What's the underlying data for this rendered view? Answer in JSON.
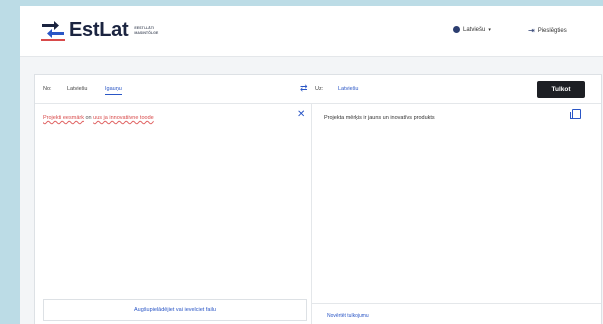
{
  "brand": {
    "name": "EstLat",
    "subtitle": "Eesti-Läti masintõlge",
    "colors": {
      "navy": "#1b2440",
      "blue": "#2a56c6",
      "red": "#d84a4a"
    }
  },
  "header": {
    "language_menu": {
      "label": "Latviešu",
      "icon": "globe-icon"
    },
    "login": {
      "label": "Pieslēgties",
      "icon": "login-icon"
    }
  },
  "translator": {
    "source_prefix": "No:",
    "source_languages": [
      "Latviešu",
      "Igauņu"
    ],
    "selected_source": "Igauņu",
    "target_prefix": "Uz:",
    "target_language": "Latviešu",
    "translate_button": "Tulkot",
    "source_text_parts": [
      "Projekti eesmärk",
      "on",
      "uus ja innovatiivne toode"
    ],
    "target_text": "Projekta mērķis ir jauns un inovatīvs produkts",
    "upload_label": "Augšupielādējiet vai ievelciet failu",
    "rate_label": "Novērtēt tulkojumu"
  }
}
